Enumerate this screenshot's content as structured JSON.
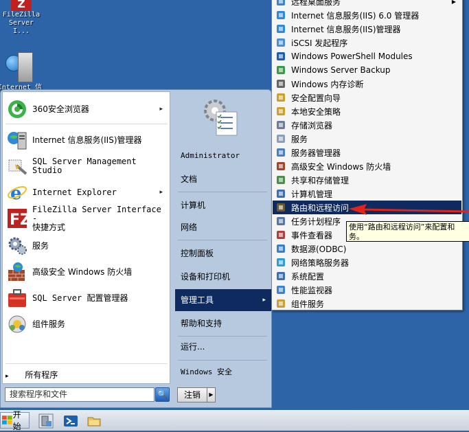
{
  "desktop": {
    "filezilla_label_line1": "FileZilla",
    "filezilla_label_line2": "Server I...",
    "filezilla_badge": "Z",
    "server_label": "Internet 信"
  },
  "start_menu": {
    "programs": [
      {
        "label": "360安全浏览器",
        "icon": "browser-360-icon",
        "has_submenu": true
      },
      {
        "label": "Internet 信息服务(IIS)管理器",
        "icon": "iis-manager-icon"
      },
      {
        "label": "SQL Server Management Studio",
        "icon": "sql-studio-icon"
      },
      {
        "label": "Internet Explorer",
        "icon": "ie-icon",
        "has_submenu": true
      },
      {
        "label": "FileZilla Server Interface -",
        "label2": "快捷方式",
        "icon": "filezilla-icon"
      },
      {
        "label": "服务",
        "icon": "services-gear-icon"
      },
      {
        "label": "高级安全 Windows 防火墙",
        "icon": "firewall-icon"
      },
      {
        "label": "SQL Server 配置管理器",
        "icon": "sql-config-icon"
      },
      {
        "label": "组件服务",
        "icon": "component-services-icon"
      }
    ],
    "all_programs": "所有程序",
    "all_programs_arrow": "▸",
    "arrow": "▸",
    "search_placeholder": "搜索程序和文件",
    "search_glyph": "🔍",
    "logoff_label": "注销",
    "logoff_arrow": "▶",
    "right_items": [
      {
        "label": "Administrator"
      },
      {
        "label": "文档"
      },
      {
        "label": "计算机"
      },
      {
        "label": "网络"
      },
      {
        "label": "控制面板"
      },
      {
        "label": "设备和打印机"
      },
      {
        "label": "管理工具",
        "active": true,
        "has_submenu": true
      },
      {
        "label": "帮助和支持"
      },
      {
        "label": "运行..."
      },
      {
        "label": "Windows 安全"
      }
    ]
  },
  "admin_tools": {
    "items": [
      {
        "label": "远程桌面服务",
        "icon": "remote-desktop-icon",
        "has_submenu": true
      },
      {
        "label": "Internet 信息服务(IIS) 6.0 管理器",
        "icon": "iis6-icon"
      },
      {
        "label": "Internet 信息服务(IIS)管理器",
        "icon": "iis-icon"
      },
      {
        "label": "iSCSI 发起程序",
        "icon": "iscsi-icon"
      },
      {
        "label": "Windows PowerShell Modules",
        "icon": "powershell-icon"
      },
      {
        "label": "Windows Server Backup",
        "icon": "backup-icon"
      },
      {
        "label": "Windows 内存诊断",
        "icon": "memory-diag-icon"
      },
      {
        "label": "安全配置向导",
        "icon": "security-wizard-icon"
      },
      {
        "label": "本地安全策略",
        "icon": "local-policy-icon"
      },
      {
        "label": "存储浏览器",
        "icon": "storage-explorer-icon"
      },
      {
        "label": "服务",
        "icon": "services-icon"
      },
      {
        "label": "服务器管理器",
        "icon": "server-manager-icon"
      },
      {
        "label": "高级安全 Windows 防火墙",
        "icon": "firewall-icon"
      },
      {
        "label": "共享和存储管理",
        "icon": "share-storage-icon"
      },
      {
        "label": "计算机管理",
        "icon": "computer-mgmt-icon"
      },
      {
        "label": "路由和远程访问",
        "icon": "routing-icon",
        "highlighted": true
      },
      {
        "label": "任务计划程序",
        "icon": "task-scheduler-icon"
      },
      {
        "label": "事件查看器",
        "icon": "event-viewer-icon"
      },
      {
        "label": "数据源(ODBC)",
        "icon": "odbc-icon"
      },
      {
        "label": "网络策略服务器",
        "icon": "nps-icon"
      },
      {
        "label": "系统配置",
        "icon": "sysconfig-icon"
      },
      {
        "label": "性能监视器",
        "icon": "perfmon-icon"
      },
      {
        "label": "组件服务",
        "icon": "component-icon"
      }
    ],
    "tooltip_line1": "使用“路由和远程访问”来配置和",
    "tooltip_line2": "务。"
  },
  "taskbar": {
    "start_label": "开始"
  }
}
